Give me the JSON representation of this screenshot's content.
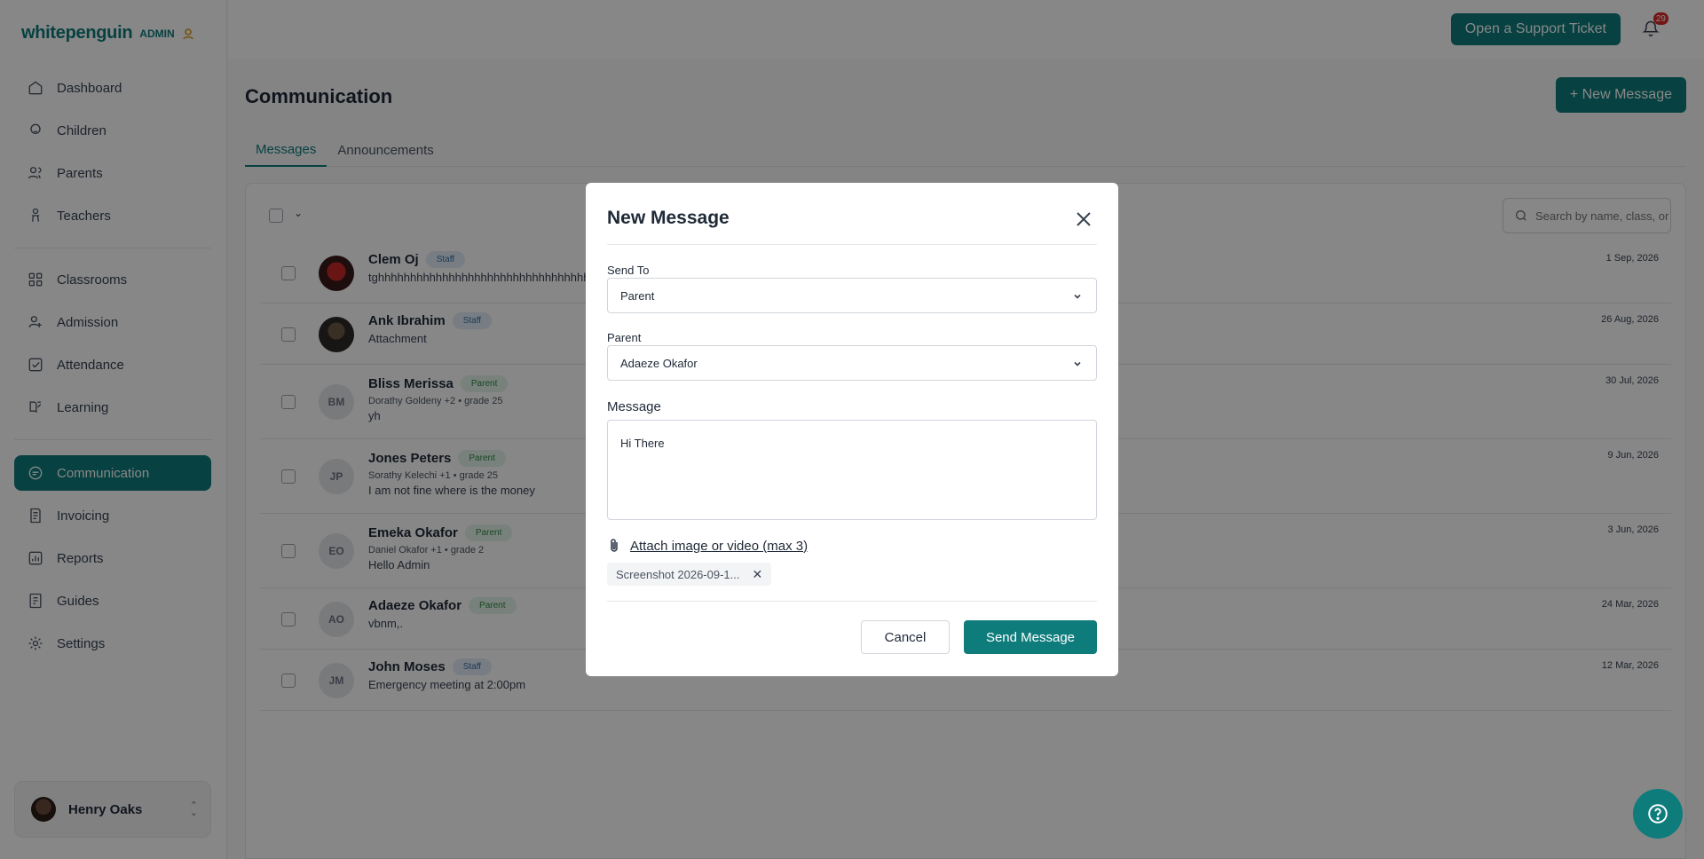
{
  "brand": {
    "name": "whitepenguin",
    "role": "ADMIN"
  },
  "sidebar": {
    "items": [
      {
        "label": "Dashboard",
        "icon": "home-icon"
      },
      {
        "label": "Children",
        "icon": "child-icon"
      },
      {
        "label": "Parents",
        "icon": "users-icon"
      },
      {
        "label": "Teachers",
        "icon": "teacher-icon"
      },
      {
        "label": "Classrooms",
        "icon": "grid-icon"
      },
      {
        "label": "Admission",
        "icon": "user-add-icon"
      },
      {
        "label": "Attendance",
        "icon": "check-square-icon"
      },
      {
        "label": "Learning",
        "icon": "book-icon"
      },
      {
        "label": "Communication",
        "icon": "chat-icon",
        "active": true
      },
      {
        "label": "Invoicing",
        "icon": "invoice-icon"
      },
      {
        "label": "Reports",
        "icon": "report-icon"
      },
      {
        "label": "Guides",
        "icon": "guide-icon"
      },
      {
        "label": "Settings",
        "icon": "gear-icon"
      }
    ],
    "user": {
      "name": "Henry Oaks"
    }
  },
  "topbar": {
    "support_label": "Open a Support Ticket",
    "notification_count": "29"
  },
  "page": {
    "title": "Communication",
    "new_message_label": "+ New Message",
    "tabs": [
      {
        "label": "Messages",
        "active": true
      },
      {
        "label": "Announcements"
      }
    ],
    "search_placeholder": "Search by name, class, or message"
  },
  "messages": [
    {
      "name": "Clem Oj",
      "role": "Staff",
      "avatar": "photo-red",
      "sub": "",
      "preview": "tghhhhhhhhhhhhhhhhhhhhhhhhhhhhhhhhhh",
      "date": "1 Sep, 2026"
    },
    {
      "name": "Ank Ibrahim",
      "role": "Staff",
      "avatar": "photo-dark",
      "sub": "",
      "preview": "Attachment",
      "date": "26 Aug, 2026"
    },
    {
      "name": "Bliss Merissa",
      "role": "Parent",
      "initials": "BM",
      "sub": "Dorathy Goldeny +2 • grade 25",
      "preview": "yh",
      "date": "30 Jul, 2026"
    },
    {
      "name": "Jones Peters",
      "role": "Parent",
      "initials": "JP",
      "sub": "Sorathy Kelechi +1 • grade 25",
      "preview": "I am not fine where is the money",
      "date": "9 Jun, 2026"
    },
    {
      "name": "Emeka Okafor",
      "role": "Parent",
      "initials": "EO",
      "sub": "Daniel Okafor +1 • grade 2",
      "preview": "Hello Admin",
      "date": "3 Jun, 2026"
    },
    {
      "name": "Adaeze Okafor",
      "role": "Parent",
      "initials": "AO",
      "sub": "",
      "preview": "vbnm,.",
      "date": "24 Mar, 2026"
    },
    {
      "name": "John Moses",
      "role": "Staff",
      "initials": "JM",
      "sub": "",
      "preview": "Emergency meeting at 2:00pm",
      "date": "12 Mar, 2026"
    }
  ],
  "modal": {
    "title": "New Message",
    "send_to_label": "Send To",
    "send_to_value": "Parent",
    "parent_label": "Parent",
    "parent_value": "Adaeze Okafor",
    "message_label": "Message",
    "message_value": "Hi There",
    "attach_label": "Attach image or video (max 3)",
    "attachment_name": "Screenshot 2026-09-1...",
    "cancel_label": "Cancel",
    "send_label": "Send Message"
  },
  "colors": {
    "accent": "#0f7c7c",
    "badge_red": "#dc2626"
  }
}
